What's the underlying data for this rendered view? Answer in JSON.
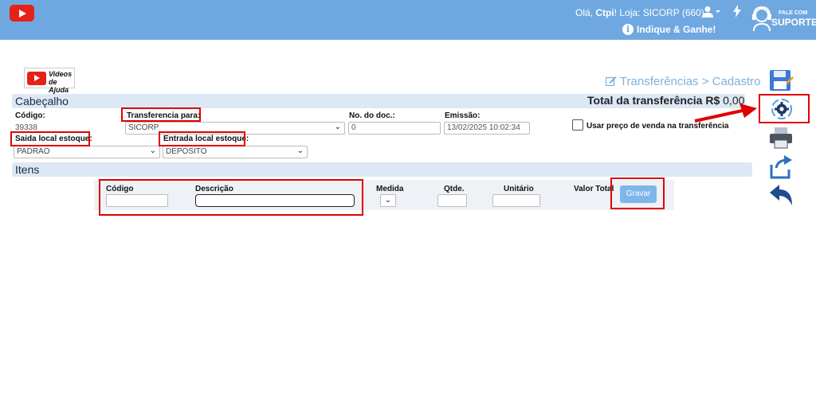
{
  "header": {
    "greeting_prefix": "Olá,",
    "user": "Ctpi",
    "store": "! Loja: SICORP (660)",
    "indique": "Indique & Ganhe!",
    "support_small": "FALE COM",
    "support_big": "SUPORTE"
  },
  "videos": {
    "line1": "Videos",
    "line2": "de Ajuda"
  },
  "page_title": "Transferências > Cadastro",
  "cabecalho": {
    "title": "Cabeçalho",
    "total_label": "Total da transferência R$",
    "total_value": "0,00",
    "codigo_label": "Código:",
    "codigo_value": "39338",
    "transferencia_label": "Transferencia para:",
    "transferencia_value": "SICORP",
    "nodoc_label": "No. do doc.:",
    "nodoc_value": "0",
    "emissao_label": "Emissão:",
    "emissao_value": "13/02/2025 10:02:34",
    "usar_preco_label": "Usar preço de venda na transferência",
    "saida_label": "Saida local estoque:",
    "saida_value": "PADRAO",
    "entrada_label": "Entrada local estoque:",
    "entrada_value": "DEPOSITO"
  },
  "itens": {
    "title": "Itens",
    "codigo": "Código",
    "descricao": "Descrição",
    "medida": "Medida",
    "qtde": "Qtde.",
    "unitario": "Unitário",
    "valor_total": "Valor Total",
    "gravar": "Gravar"
  },
  "colors": {
    "topbar": "#6fa8e0",
    "highlight": "#e00000",
    "section": "#dce8f4"
  }
}
